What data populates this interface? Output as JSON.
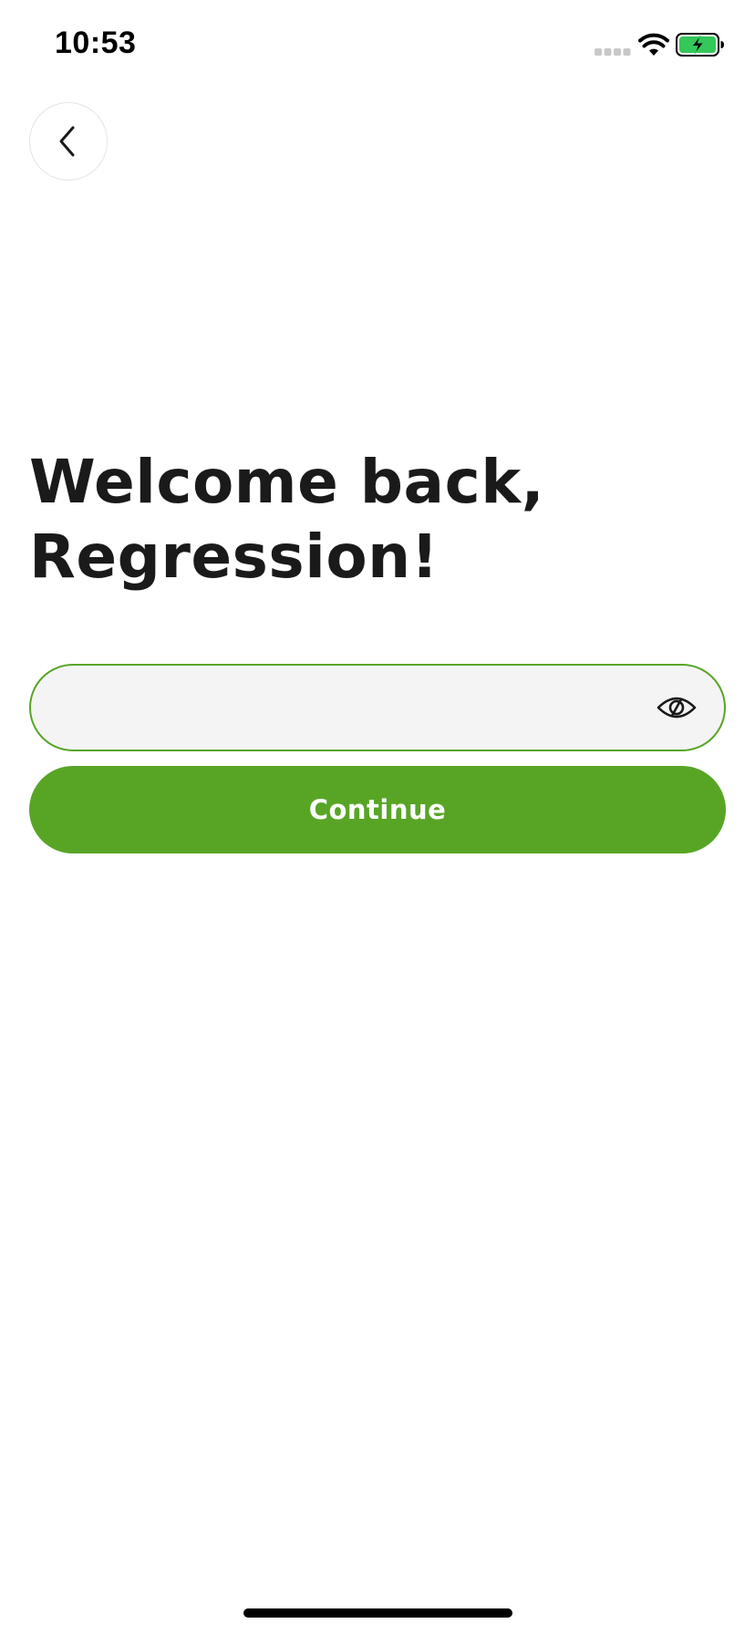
{
  "status_bar": {
    "time": "10:53",
    "icons": [
      "signal-icon",
      "wifi-icon",
      "battery-charging-icon"
    ]
  },
  "back_button": {
    "icon": "chevron-left-icon"
  },
  "header": {
    "title_line1": "Welcome back,",
    "title_line2": "Regression!"
  },
  "password": {
    "value": "",
    "placeholder": "",
    "toggle_icon": "eye-slash-icon"
  },
  "continue_button": {
    "label": "Continue"
  },
  "colors": {
    "accent": "#58a526",
    "field_background": "#f4f4f4",
    "text": "#1a1a1a",
    "battery_fill": "#34c759"
  }
}
